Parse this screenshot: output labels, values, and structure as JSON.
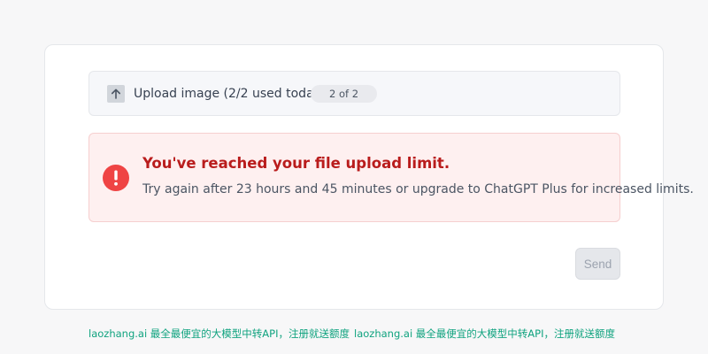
{
  "upload": {
    "label": "Upload image (2/2 used today)",
    "counter": "2 of 2",
    "icon": "arrow-up-icon"
  },
  "alert": {
    "title": "You've reached your file upload limit.",
    "message": "Try again after 23 hours and 45 minutes or upgrade to ChatGPT Plus for increased limits.",
    "icon": "exclamation-circle-icon",
    "color": "#ef4444"
  },
  "actions": {
    "send_label": "Send"
  },
  "footer": {
    "text": "laozhang.ai 最全最便宜的大模型中转API，注册就送额度",
    "color": "#10a37f"
  }
}
